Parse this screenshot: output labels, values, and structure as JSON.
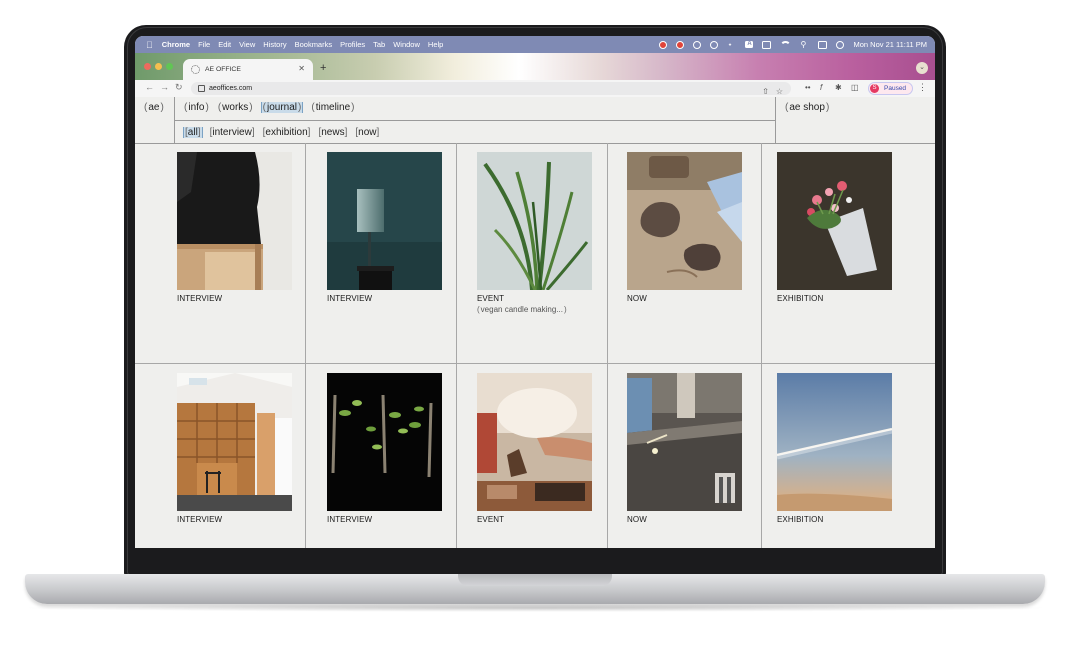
{
  "menubar": {
    "app": "Chrome",
    "items": [
      "File",
      "Edit",
      "View",
      "History",
      "Bookmarks",
      "Profiles",
      "Tab",
      "Window",
      "Help"
    ],
    "clock": "Mon Nov 21  11:11 PM",
    "input_icon_letter": "A"
  },
  "browser": {
    "tab_title": "AE OFFICE",
    "url": "aeoffices.com",
    "profile_initial": "S",
    "profile_status": "Paused"
  },
  "site": {
    "logo": "ae",
    "nav": [
      {
        "label": "info",
        "active": false
      },
      {
        "label": "works",
        "active": false
      },
      {
        "label": "journal",
        "active": true
      },
      {
        "label": "timeline",
        "active": false
      }
    ],
    "filters": [
      {
        "label": "all",
        "active": true
      },
      {
        "label": "interview",
        "active": false
      },
      {
        "label": "exhibition",
        "active": false
      },
      {
        "label": "news",
        "active": false
      },
      {
        "label": "now",
        "active": false
      }
    ],
    "shop": "ae shop"
  },
  "posts": [
    {
      "category": "INTERVIEW",
      "subtitle": "",
      "image": "person-on-stool"
    },
    {
      "category": "INTERVIEW",
      "subtitle": "",
      "image": "teal-lamp"
    },
    {
      "category": "EVENT",
      "subtitle": "vegan candle making...",
      "image": "green-plant"
    },
    {
      "category": "NOW",
      "subtitle": "",
      "image": "clay-on-table"
    },
    {
      "category": "EXHIBITION",
      "subtitle": "",
      "image": "flowers-on-floor"
    },
    {
      "category": "INTERVIEW",
      "subtitle": "",
      "image": "wooden-shelves-room"
    },
    {
      "category": "INTERVIEW",
      "subtitle": "",
      "image": "branches-on-black"
    },
    {
      "category": "EVENT",
      "subtitle": "",
      "image": "candle-pouring"
    },
    {
      "category": "NOW",
      "subtitle": "",
      "image": "workshop-grinder"
    },
    {
      "category": "EXHIBITION",
      "subtitle": "",
      "image": "sky-contrail"
    }
  ],
  "colors": {
    "menubar": "#7f8ab4",
    "page_bg": "#efefed",
    "active_highlight": "#c9dbe9"
  }
}
